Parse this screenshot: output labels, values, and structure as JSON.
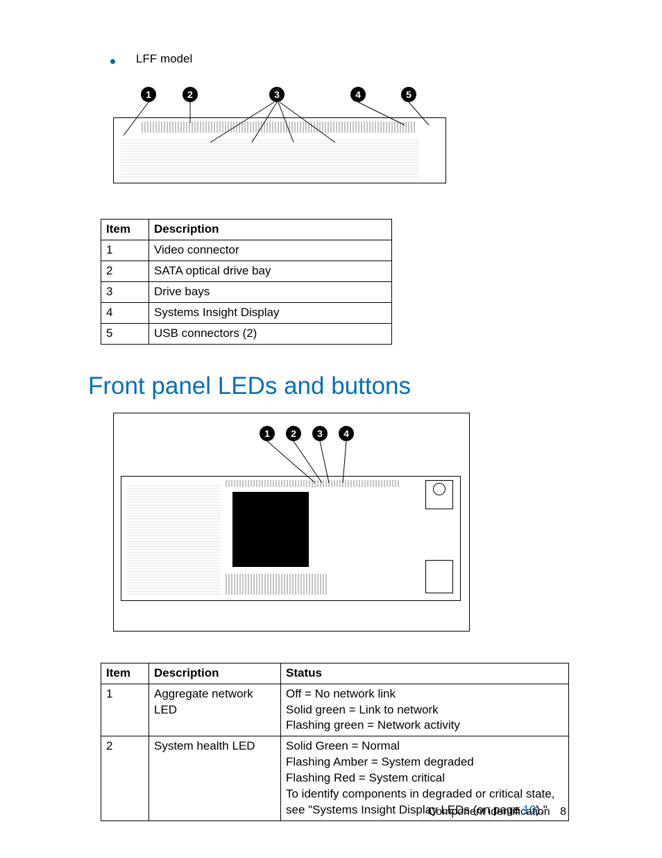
{
  "bullet": {
    "label": "LFF model"
  },
  "diagram1": {
    "callouts": [
      "1",
      "2",
      "3",
      "4",
      "5"
    ]
  },
  "table1": {
    "headers": {
      "item": "Item",
      "desc": "Description"
    },
    "rows": [
      {
        "item": "1",
        "desc": "Video connector"
      },
      {
        "item": "2",
        "desc": "SATA optical drive bay"
      },
      {
        "item": "3",
        "desc": "Drive bays"
      },
      {
        "item": "4",
        "desc": "Systems Insight Display"
      },
      {
        "item": "5",
        "desc": "USB connectors (2)"
      }
    ]
  },
  "section_title": "Front panel LEDs and buttons",
  "diagram2": {
    "callouts": [
      "1",
      "2",
      "3",
      "4"
    ]
  },
  "table2": {
    "headers": {
      "item": "Item",
      "desc": "Description",
      "status": "Status"
    },
    "rows": [
      {
        "item": "1",
        "desc": "Aggregate network LED",
        "status_lines": [
          "Off = No network link",
          "Solid green = Link to network",
          "Flashing green = Network activity"
        ]
      },
      {
        "item": "2",
        "desc": "System health LED",
        "status_lines": [
          "Solid Green = Normal",
          "Flashing Amber = System degraded",
          "Flashing Red = System critical",
          "To identify components in degraded or critical state, see \"Systems Insight Display LEDs (on page "
        ],
        "link_text": "10",
        "tail_text": ").\""
      }
    ]
  },
  "footer": {
    "section": "Component identification",
    "page": "8"
  }
}
